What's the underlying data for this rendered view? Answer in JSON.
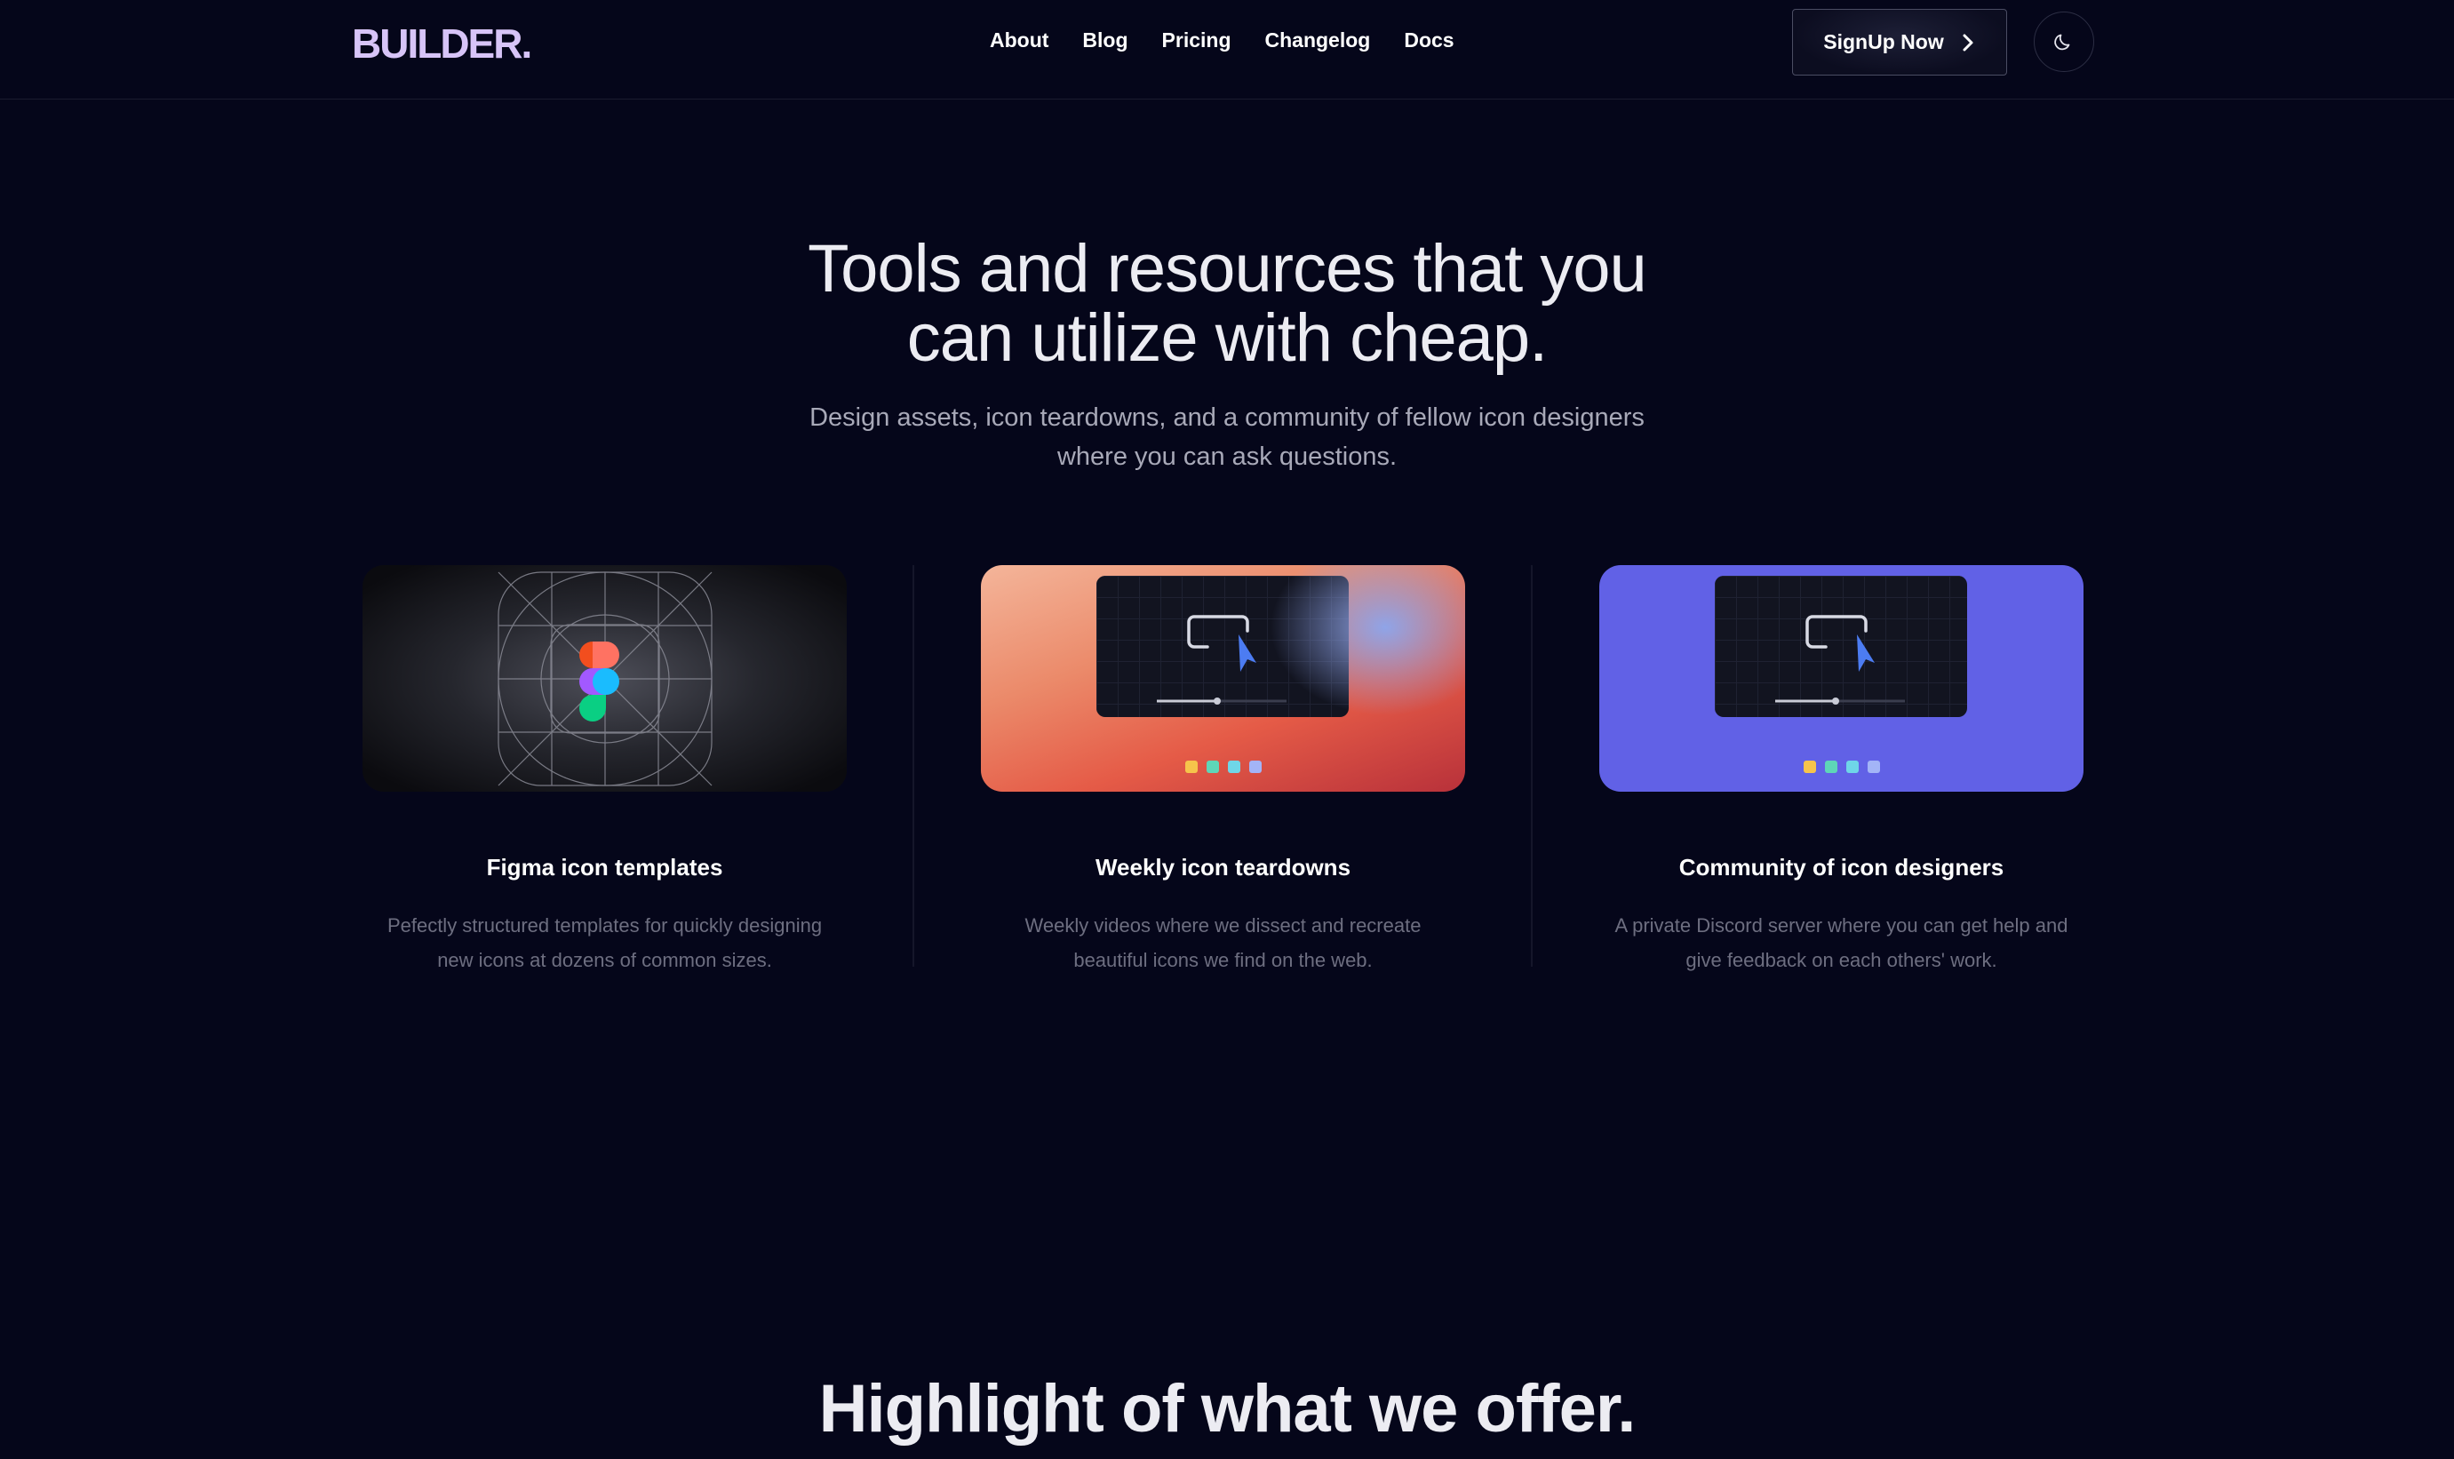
{
  "header": {
    "logo": "BUILDER.",
    "nav": [
      "About",
      "Blog",
      "Pricing",
      "Changelog",
      "Docs"
    ],
    "signup_label": "SignUp Now",
    "theme_toggle_icon": "moon-icon"
  },
  "hero": {
    "title_line1": "Tools and resources that you",
    "title_line2": "can utilize with cheap.",
    "subtitle_line1": "Design assets, icon teardowns, and a community of fellow icon designers",
    "subtitle_line2": "where you can ask questions."
  },
  "cards": [
    {
      "title": "Figma icon templates",
      "desc_line1": "Pefectly structured templates for quickly designing",
      "desc_line2": "new icons at dozens of common sizes.",
      "icon": "figma-logo-icon"
    },
    {
      "title": "Weekly icon teardowns",
      "desc_line1": "Weekly videos where we dissect and recreate",
      "desc_line2": "beautiful icons we find on the web.",
      "icon": "video-player-icon"
    },
    {
      "title": "Community of icon designers",
      "desc_line1": "A private Discord server where you can get help and",
      "desc_line2": "give feedback on each others' work.",
      "icon": "video-player-icon"
    }
  ],
  "section2": {
    "title": "Highlight of what we offer."
  },
  "colors": {
    "background": "#05061a",
    "logo": "#d7c4f7",
    "card3_bg": "#6161e6",
    "dot_colors": [
      "#f6c44b",
      "#5ed6b8",
      "#6fd6e8",
      "#a3b4f7"
    ],
    "figma_colors": [
      "#f24e1e",
      "#ff7262",
      "#a259ff",
      "#1abcfe",
      "#0acf83"
    ]
  }
}
